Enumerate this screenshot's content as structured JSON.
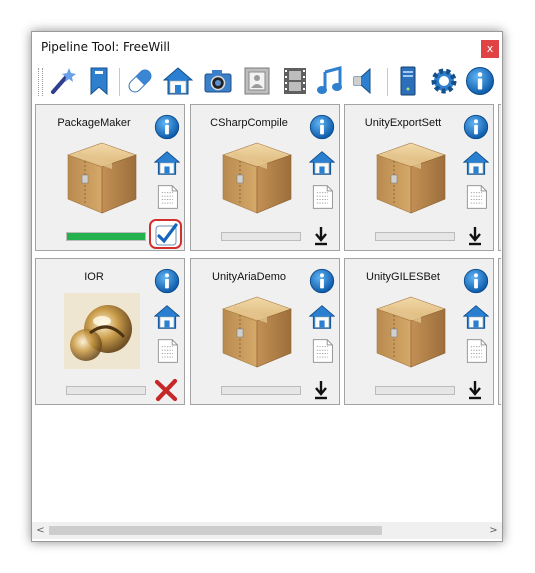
{
  "window": {
    "title": "Pipeline Tool: FreeWill",
    "close_label": "x"
  },
  "toolbar": {
    "buttons": [
      "wand-icon",
      "bookmark-icon",
      "pill-icon",
      "home-icon",
      "camera-icon",
      "picture-frame-icon",
      "film-icon",
      "music-note-icon",
      "speaker-icon",
      "server-icon",
      "gear-icon",
      "info-icon"
    ]
  },
  "packages": [
    {
      "name": "PackageMaker",
      "thumbnail": "package-box",
      "progress": 1.0,
      "status": "installed"
    },
    {
      "name": "CSharpCompile",
      "thumbnail": "package-box",
      "progress": 0,
      "status": "download"
    },
    {
      "name": "UnityExportSett",
      "thumbnail": "package-box",
      "progress": 0,
      "status": "download"
    },
    {
      "name": "IOR",
      "thumbnail": "glass-spheres",
      "progress": 0,
      "status": "failed"
    },
    {
      "name": "UnityAriaDemo",
      "thumbnail": "package-box",
      "progress": 0,
      "status": "download"
    },
    {
      "name": "UnityGILESBet",
      "thumbnail": "package-box",
      "progress": 0,
      "status": "download"
    }
  ],
  "colors": {
    "progress_fill": "#22b14c",
    "info_blue": "#1a73c8",
    "close_red": "#e04343",
    "card_bg": "#f0f0f0"
  },
  "scrollbar": {
    "left_arrow": "<",
    "right_arrow": ">"
  }
}
